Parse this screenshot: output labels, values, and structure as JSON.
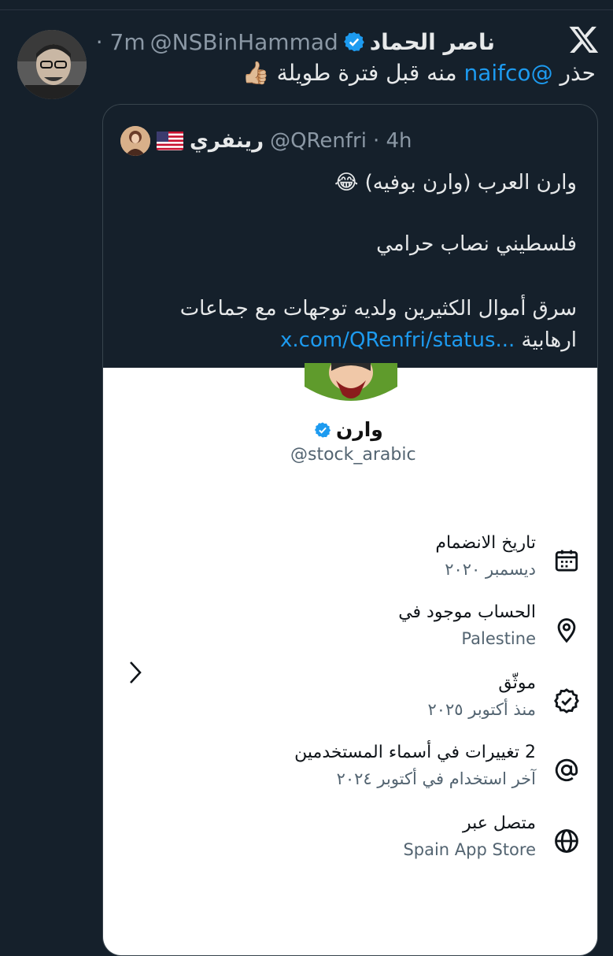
{
  "tweet": {
    "author_name": "ناصر الحماد",
    "author_handle": "@NSBinHammad",
    "time": "· 7m",
    "text_prefix": "حذر ",
    "mention": "@naifco",
    "text_suffix": " منه قبل فترة طويلة 👍🏼"
  },
  "quote": {
    "author_name": "رينفري",
    "flag": "🇺🇸",
    "author_handle": "@QRenfri",
    "time": "· 4h",
    "lines": [
      "وارن العرب (وارن بوفيه) 😂",
      "فلسطيني نصاب حرامي",
      "سرق أموال الكثيرين ولديه توجهات مع جماعات"
    ],
    "last_line_prefix": "ارهابية ",
    "link": "x.com/QRenfri/status..."
  },
  "profile": {
    "name": "وارن",
    "handle": "@stock_arabic",
    "rows": [
      {
        "icon": "calendar-icon",
        "title": "تاريخ الانضمام",
        "sub": "ديسمبر ٢٠٢٠"
      },
      {
        "icon": "location-pin-icon",
        "title": "الحساب موجود في",
        "sub": "Palestine"
      },
      {
        "icon": "verified-check-icon",
        "title": "موثّق",
        "sub": "منذ أكتوبر ٢٠٢٥"
      },
      {
        "icon": "at-sign-icon",
        "title": "2 تغييرات في أسماء المستخدمين",
        "sub": "آخر استخدام في أكتوبر ٢٠٢٤"
      },
      {
        "icon": "globe-icon",
        "title": "متصل عبر",
        "sub": "Spain App Store"
      }
    ]
  },
  "colors": {
    "background": "#15202b",
    "accent": "#1d9bf0",
    "muted": "#8b98a5"
  }
}
